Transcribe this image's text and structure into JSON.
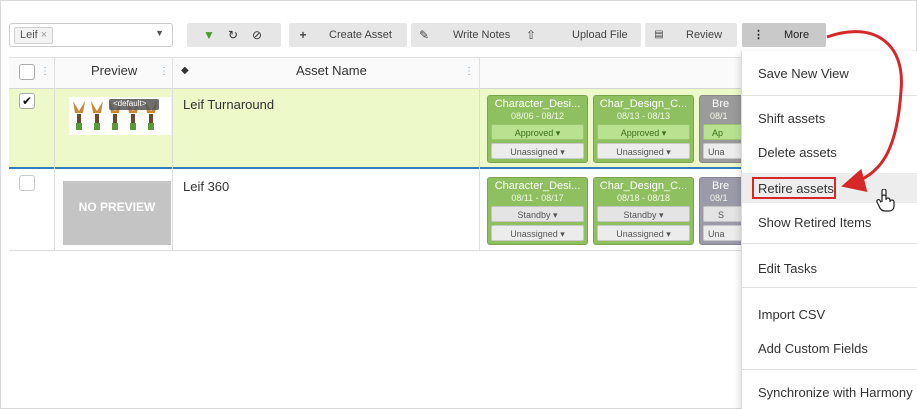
{
  "toolbar": {
    "filter_chip": "Leif",
    "create_asset": "Create Asset",
    "write_notes": "Write Notes",
    "upload_file": "Upload File",
    "review": "Review",
    "more": "More"
  },
  "table": {
    "headers": {
      "preview": "Preview",
      "asset_name": "Asset Name"
    },
    "rows": [
      {
        "selected": true,
        "thumbnail_label": "<default>",
        "asset_name": "Leif Turnaround",
        "tasks": [
          {
            "title": "Character_Desi...",
            "dates": "08/06 - 08/12",
            "status": "Approved",
            "assignee": "Unassigned"
          },
          {
            "title": "Char_Design_C...",
            "dates": "08/13 - 08/13",
            "status": "Approved",
            "assignee": "Unassigned"
          },
          {
            "title": "Bre",
            "dates": "08/1",
            "status": "Ap",
            "assignee": "Una"
          }
        ]
      },
      {
        "selected": false,
        "no_preview": "NO PREVIEW",
        "asset_name": "Leif 360",
        "tasks": [
          {
            "title": "Character_Desi...",
            "dates": "08/11 - 08/17",
            "status": "Standby",
            "assignee": "Unassigned"
          },
          {
            "title": "Char_Design_C...",
            "dates": "08/18 - 08/18",
            "status": "Standby",
            "assignee": "Unassigned"
          },
          {
            "title": "Bre",
            "dates": "08/1",
            "status": "S",
            "assignee": "Una"
          }
        ]
      }
    ]
  },
  "menu": {
    "items": [
      "Save New View",
      "Shift assets",
      "Delete assets",
      "Retire assets",
      "Show Retired Items",
      "Edit Tasks",
      "Import CSV",
      "Add Custom Fields",
      "Synchronize with Harmony"
    ],
    "highlighted": "Retire assets"
  },
  "colors": {
    "selected_row": "#edf9c8",
    "task_green": "#8fc060",
    "annotation_red": "#d62828",
    "row_accent_blue": "#2f7fc1"
  }
}
